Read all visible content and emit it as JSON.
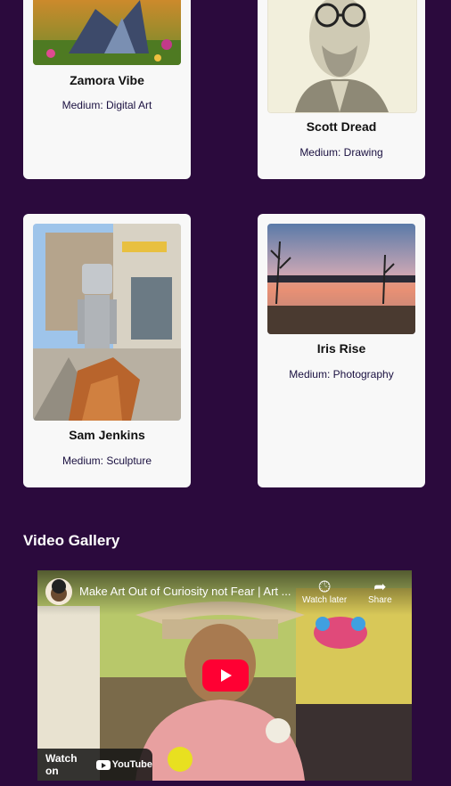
{
  "artists": [
    {
      "name": "Zamora Vibe",
      "medium": "Medium: Digital Art"
    },
    {
      "name": "Scott Dread",
      "medium": "Medium: Drawing"
    },
    {
      "name": "Sam Jenkins",
      "medium": "Medium: Sculpture"
    },
    {
      "name": "Iris Rise",
      "medium": "Medium: Photography"
    }
  ],
  "video_gallery": {
    "title": "Video Gallery",
    "video": {
      "title": "Make Art Out of Curiosity not Fear | Art ...",
      "watch_later": "Watch later",
      "share": "Share",
      "watch_on": "Watch on",
      "youtube": "YouTube",
      "icons": [
        "clock-icon",
        "share-icon",
        "play-icon"
      ]
    }
  },
  "colors": {
    "background": "#2b0a3d",
    "card": "#f8f8f8",
    "play_button": "#ff0033"
  }
}
